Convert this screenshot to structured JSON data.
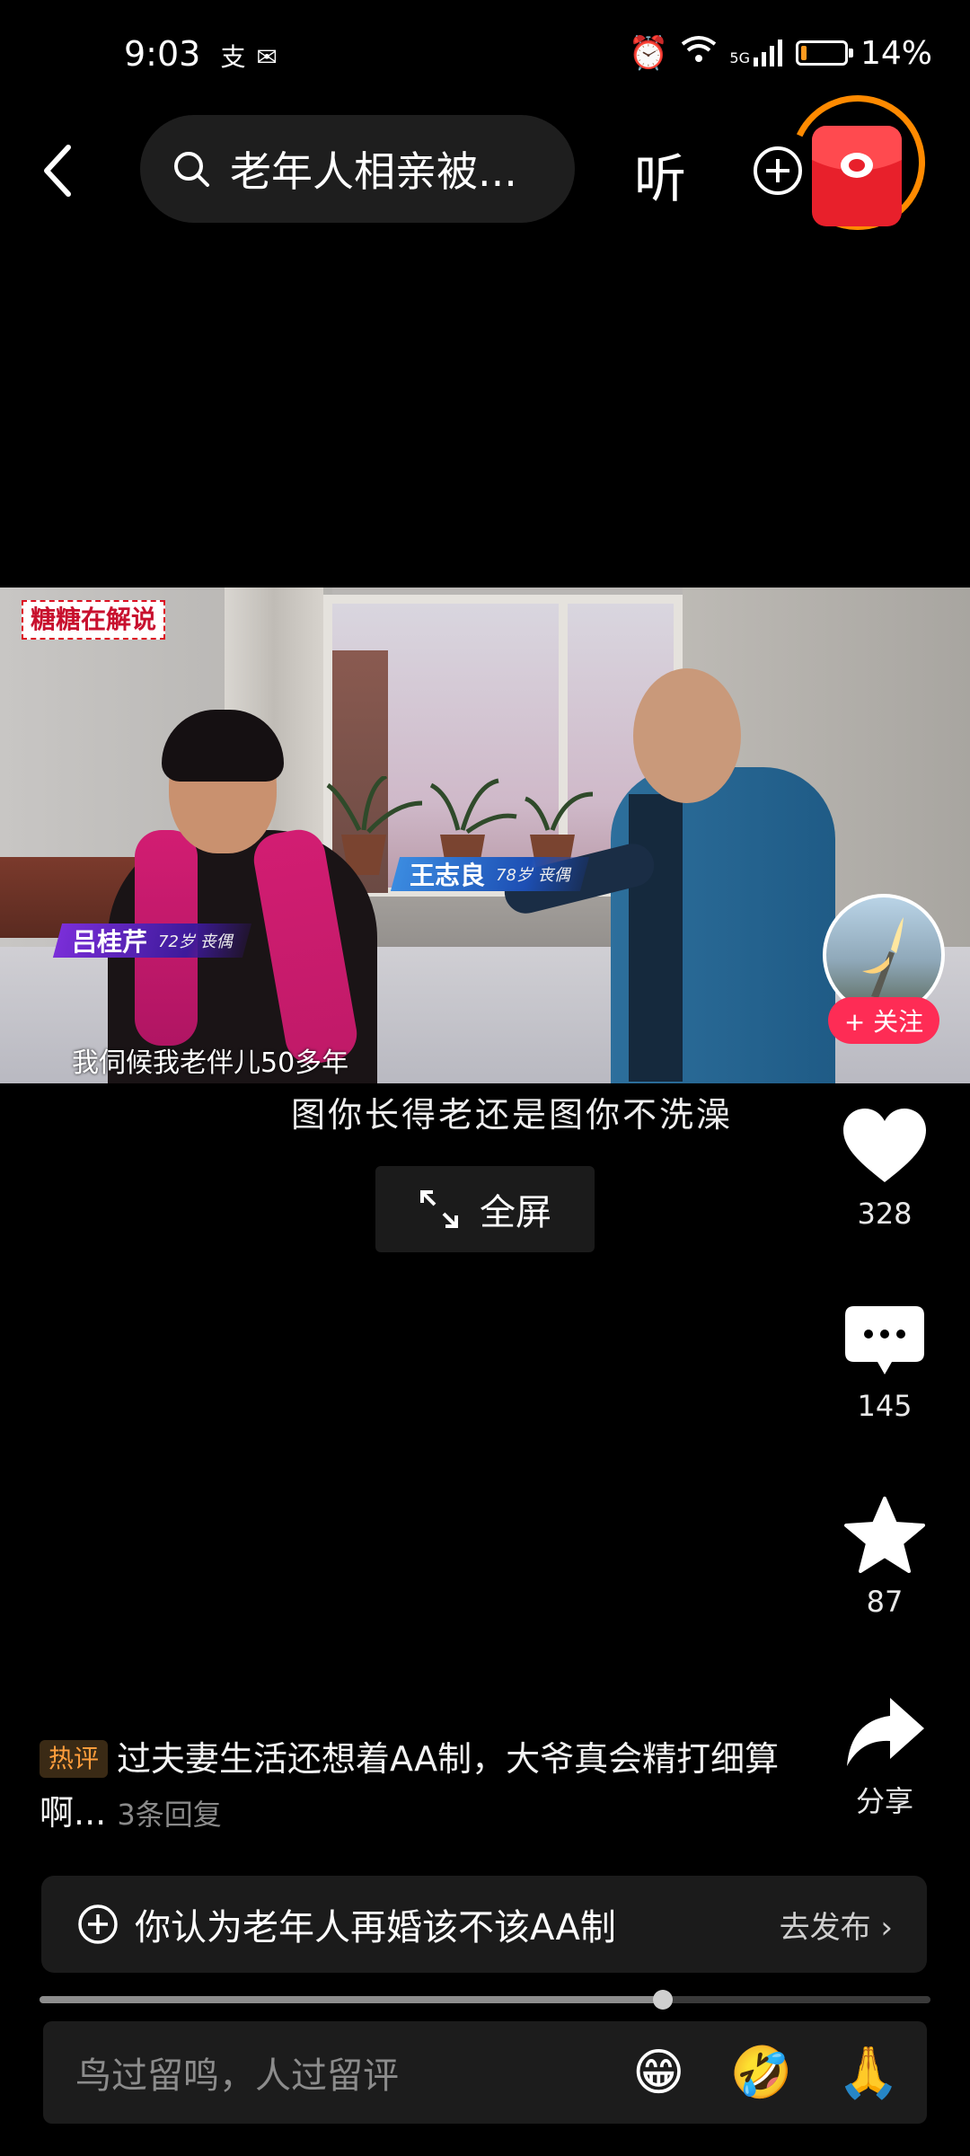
{
  "status_bar": {
    "time": "9:03",
    "left_icons": [
      "alipay-icon",
      "wechat-icon"
    ],
    "network": "5G",
    "battery": "14%",
    "battery_level": 0.14,
    "battery_color": "#ff9a1f"
  },
  "top_bar": {
    "search_text": "老年人相亲被...",
    "listen_label": "听"
  },
  "video": {
    "channel_tag": "糖糖在解说",
    "woman_name": "吕桂芹",
    "woman_info": "72岁 丧偶",
    "man_name": "王志良",
    "man_info": "78岁 丧偶",
    "burned_subtitle": "我伺候我老伴儿50多年"
  },
  "subtitle": "图你长得老还是图你不洗澡",
  "fullscreen_label": "全屏",
  "rail": {
    "follow_label": "+ 关注",
    "likes": "328",
    "comments": "145",
    "favorites": "87",
    "share_label": "分享"
  },
  "hot_comment": {
    "tag": "热评",
    "text": "过夫妻生活还想着AA制，大爷真会精打细算啊...",
    "replies": "3条回复"
  },
  "topic": {
    "text": "你认为老年人再婚该不该AA制",
    "action": "去发布"
  },
  "progress": 0.7,
  "comment_bar": {
    "placeholder": "鸟过留鸣，人过留评",
    "emojis": [
      "😁",
      "🤣",
      "🙏"
    ]
  },
  "colors": {
    "accent_red": "#fe2c55",
    "hot_tag": "#ff9d3c",
    "red_packet": "#e8202b",
    "red_packet_ring": "#ff8a00"
  }
}
